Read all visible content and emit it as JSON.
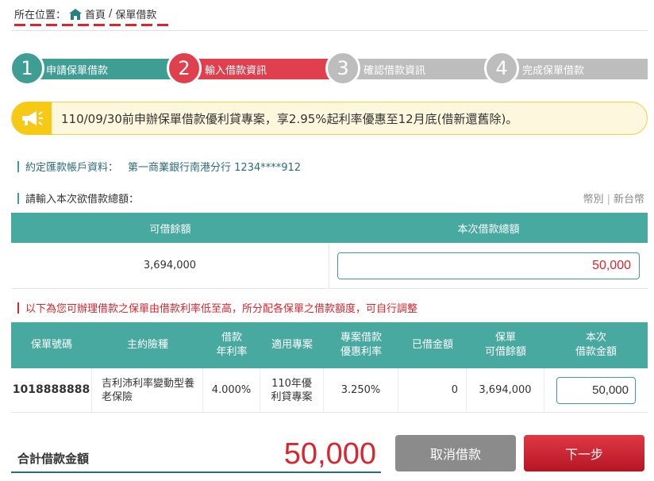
{
  "breadcrumb": {
    "prefix": "所在位置：",
    "home": "首頁",
    "separator": "/",
    "current": "保單借款"
  },
  "steps": [
    {
      "number": "1",
      "label": "申請保單借款"
    },
    {
      "number": "2",
      "label": "輸入借款資訊"
    },
    {
      "number": "3",
      "label": "確認借款資訊"
    },
    {
      "number": "4",
      "label": "完成保單借款"
    }
  ],
  "promo": {
    "text": "110/09/30前申辦保單借款優利貸專案，享2.95%起利率優惠至12月底(借新還舊除)。"
  },
  "account": {
    "label": "約定匯款帳戶資料：",
    "value": "第一商業銀行南港分行 1234****912"
  },
  "amount_section": {
    "label": "請輸入本次欲借款總額：",
    "currency_label": "幣別",
    "currency_sep": "|",
    "currency_value": "新台幣"
  },
  "summary_table": {
    "headers": [
      "可借餘額",
      "本次借款總額"
    ],
    "available": "3,694,000",
    "total_input": "50,000"
  },
  "note": "以下為您可辦理借款之保單由借款利率低至高，所分配各保單之借款額度，可自行調整",
  "policy_table": {
    "headers": [
      "保單號碼",
      "主約險種",
      "借款\n年利率",
      "適用專案",
      "專案借款\n優惠利率",
      "已借金額",
      "保單\n可借餘額",
      "本次\n借款金額"
    ],
    "rows": [
      {
        "policy_no": "1018888888",
        "product": "吉利沛利率變動型養老保險",
        "rate": "4.000%",
        "project": "110年優利貸專案",
        "promo_rate": "3.250%",
        "borrowed": "0",
        "available": "3,694,000",
        "amount": "50,000"
      }
    ]
  },
  "footer": {
    "total_label": "合計借款金額",
    "total_value": "50,000",
    "cancel": "取消借款",
    "next": "下一步"
  },
  "colors": {
    "teal": "#48a9a1",
    "red": "#e0404e",
    "gray": "#bdbdbd",
    "promo_yellow": "#f6c915"
  }
}
